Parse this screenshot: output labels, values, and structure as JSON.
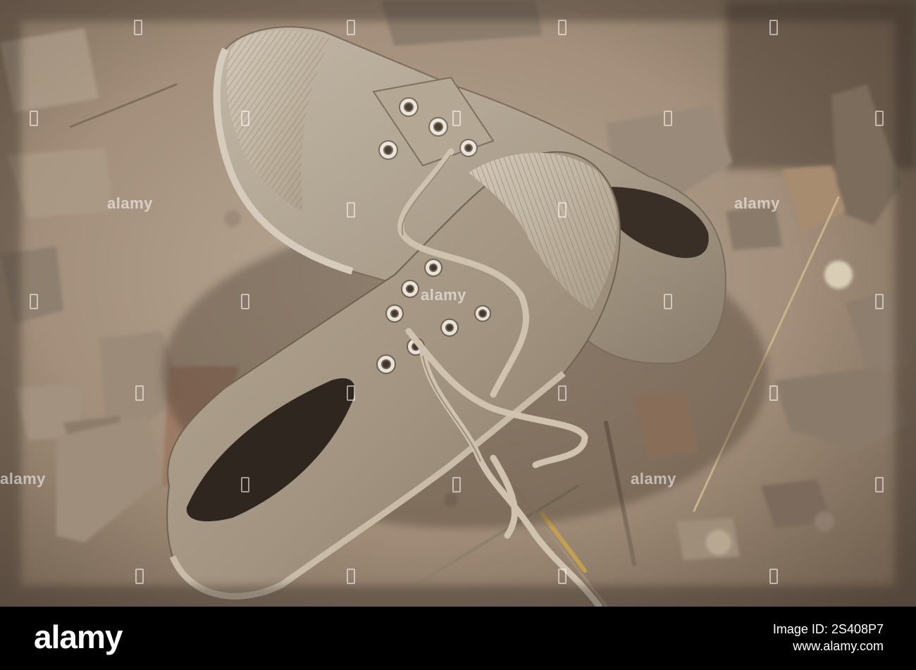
{
  "photo": {
    "subject": "old-canvas-sneakers-on-dirt"
  },
  "watermark": {
    "text": "alamy"
  },
  "footer": {
    "brand": "alamy",
    "image_id_label": "Image ID: 2S408P7",
    "site": "www.alamy.com"
  }
}
